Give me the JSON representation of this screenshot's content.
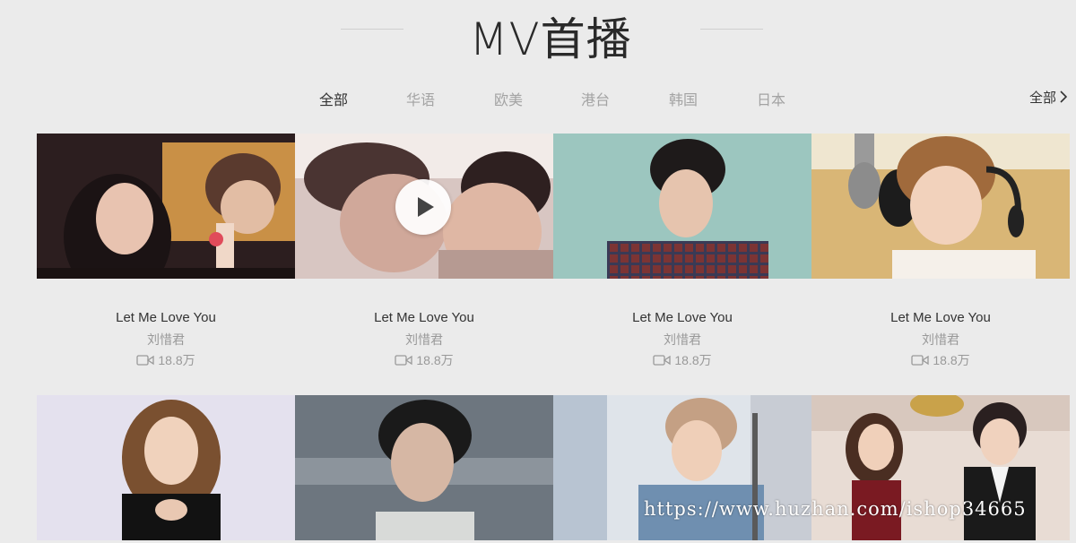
{
  "header": {
    "title": "MV首播"
  },
  "tabs": [
    {
      "label": "全部",
      "active": true
    },
    {
      "label": "华语",
      "active": false
    },
    {
      "label": "欧美",
      "active": false
    },
    {
      "label": "港台",
      "active": false
    },
    {
      "label": "韩国",
      "active": false
    },
    {
      "label": "日本",
      "active": false
    }
  ],
  "all_link": {
    "label": "全部"
  },
  "mvs": [
    {
      "title": "Let Me Love You",
      "artist": "刘惜君",
      "plays": "18.8万"
    },
    {
      "title": "Let Me Love You",
      "artist": "刘惜君",
      "plays": "18.8万"
    },
    {
      "title": "Let Me Love You",
      "artist": "刘惜君",
      "plays": "18.8万"
    },
    {
      "title": "Let Me Love You",
      "artist": "刘惜君",
      "plays": "18.8万"
    }
  ],
  "watermark": "https://www.huzhan.com/ishop34665",
  "colors": {
    "background": "#ebebeb",
    "active_tab": "#333333",
    "inactive_tab": "#a3a3a3",
    "meta_text": "#999999"
  }
}
